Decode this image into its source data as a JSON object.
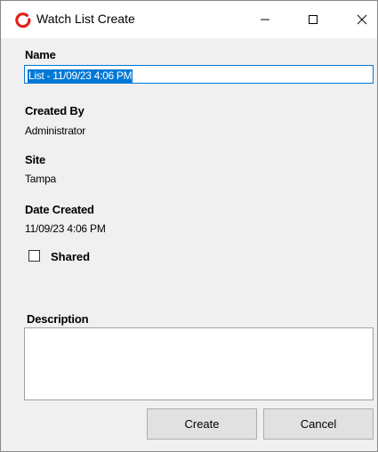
{
  "window": {
    "title": "Watch List Create",
    "icon": "red-ring-app-icon",
    "controls": [
      "minimize-icon",
      "maximize-icon",
      "close-icon"
    ]
  },
  "form": {
    "name_label": "Name",
    "name_value": "List - 11/09/23 4:06 PM",
    "created_by_label": "Created By",
    "created_by_value": "Administrator",
    "site_label": "Site",
    "site_value": "Tampa",
    "date_created_label": "Date Created",
    "date_created_value": "11/09/23 4:06 PM",
    "shared_label": "Shared",
    "shared_checked": false,
    "description_label": "Description",
    "description_value": ""
  },
  "buttons": {
    "create_label": "Create",
    "cancel_label": "Cancel"
  },
  "colors": {
    "selection": "#0078d7",
    "window_bg": "#f0f0f0",
    "app_icon_red": "#e2231a"
  }
}
